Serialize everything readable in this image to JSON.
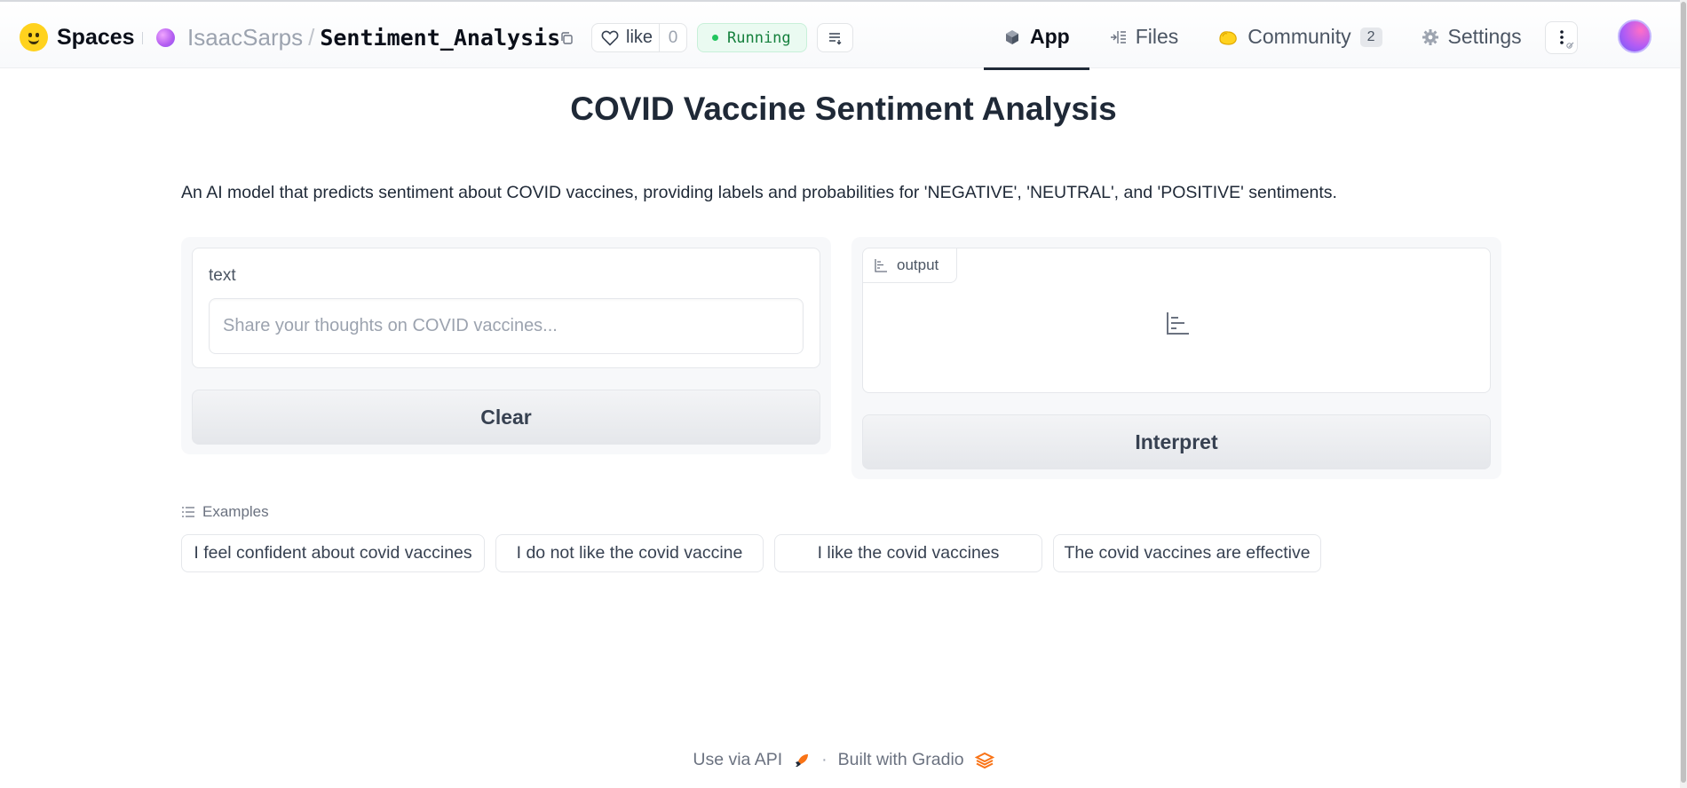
{
  "header": {
    "brand": "Spaces",
    "owner": "IsaacSarps",
    "slash": "/",
    "repo_name": "Sentiment_Analysis",
    "like_label": "like",
    "like_count": "0",
    "status": "Running",
    "status_color": "#15803d",
    "tabs": [
      {
        "label": "App",
        "icon": "cube-icon",
        "active": true
      },
      {
        "label": "Files",
        "icon": "files-icon",
        "active": false
      },
      {
        "label": "Community",
        "icon": "community-icon",
        "badge": "2",
        "active": false
      },
      {
        "label": "Settings",
        "icon": "gear-icon",
        "active": false
      }
    ]
  },
  "main": {
    "title": "COVID Vaccine Sentiment Analysis",
    "description": "An AI model that predicts sentiment about COVID vaccines, providing labels and probabilities for 'NEGATIVE', 'NEUTRAL', and 'POSITIVE' sentiments.",
    "input": {
      "label": "text",
      "placeholder": "Share your thoughts on COVID vaccines...",
      "value": ""
    },
    "clear_label": "Clear",
    "output_label": "output",
    "interpret_label": "Interpret",
    "examples_label": "Examples",
    "examples": [
      "I feel confident about covid vaccines",
      "I do not like the covid vaccine",
      "I like the covid vaccines",
      "The covid vaccines are effective"
    ]
  },
  "footer": {
    "api_label": "Use via API",
    "separator": "·",
    "built_label": "Built with Gradio"
  },
  "colors": {
    "accent": "#1f2937",
    "running_bg": "#eafaf1",
    "gradio_orange": "#f97316"
  }
}
